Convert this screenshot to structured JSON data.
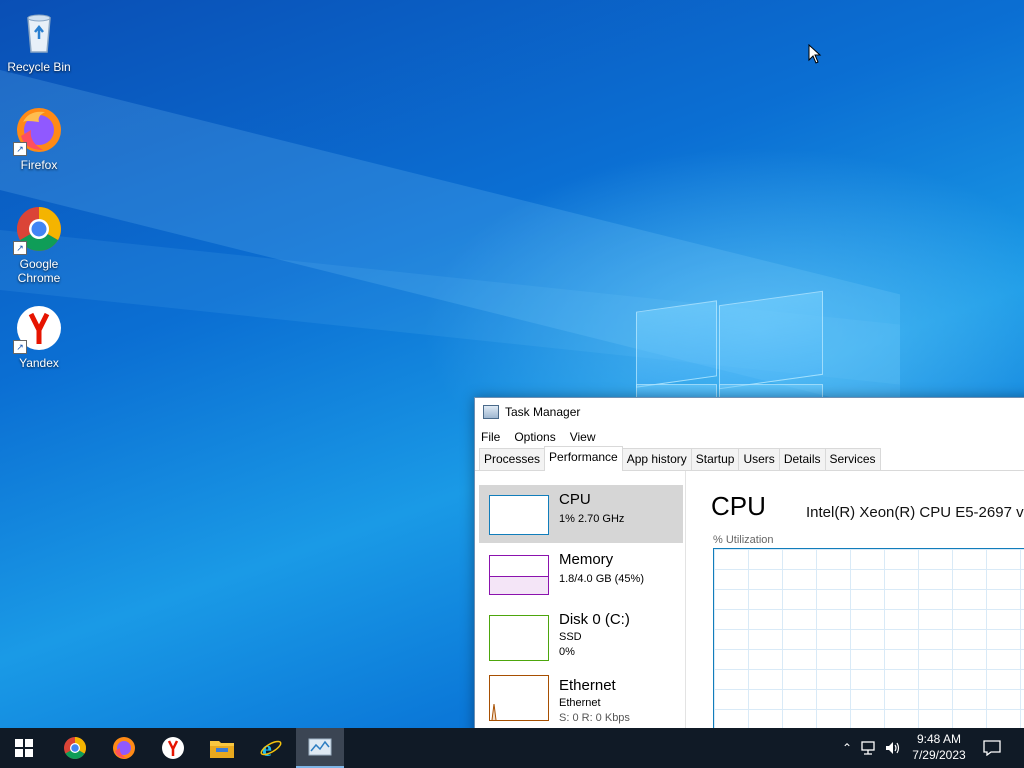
{
  "desktop": {
    "icons": [
      {
        "label": "Recycle Bin",
        "icon": "recycle-bin-icon"
      },
      {
        "label": "Firefox",
        "icon": "firefox-icon"
      },
      {
        "label": "Google Chrome",
        "icon": "chrome-icon"
      },
      {
        "label": "Yandex",
        "icon": "yandex-icon"
      }
    ]
  },
  "task_manager": {
    "title": "Task Manager",
    "menu": [
      "File",
      "Options",
      "View"
    ],
    "tabs": [
      "Processes",
      "Performance",
      "App history",
      "Startup",
      "Users",
      "Details",
      "Services"
    ],
    "active_tab": "Performance",
    "resources": [
      {
        "name": "CPU",
        "line1": "1%  2.70 GHz",
        "line2": "",
        "color": "#117dbb"
      },
      {
        "name": "Memory",
        "line1": "1.8/4.0 GB (45%)",
        "line2": "",
        "color": "#8b12ae"
      },
      {
        "name": "Disk 0 (C:)",
        "line1": "SSD",
        "line2": "0%",
        "color": "#4da60c"
      },
      {
        "name": "Ethernet",
        "line1": "Ethernet",
        "line2": "S: 0  R: 0 Kbps",
        "color": "#a74f01"
      }
    ],
    "detail": {
      "title": "CPU",
      "model": "Intel(R) Xeon(R) CPU E5-2697 v",
      "graph_label": "% Utilization"
    }
  },
  "taskbar": {
    "apps": [
      "start-icon",
      "chrome-icon",
      "firefox-icon",
      "yandex-icon",
      "file-explorer-icon",
      "internet-explorer-icon",
      "task-manager-icon"
    ],
    "active_app": "task-manager-icon",
    "time": "9:48 AM",
    "date": "7/29/2023"
  },
  "colors": {
    "desktop_blue": "#0b6fd3",
    "taskbar": "#101a26",
    "cpu_graph": "#117dbb"
  }
}
